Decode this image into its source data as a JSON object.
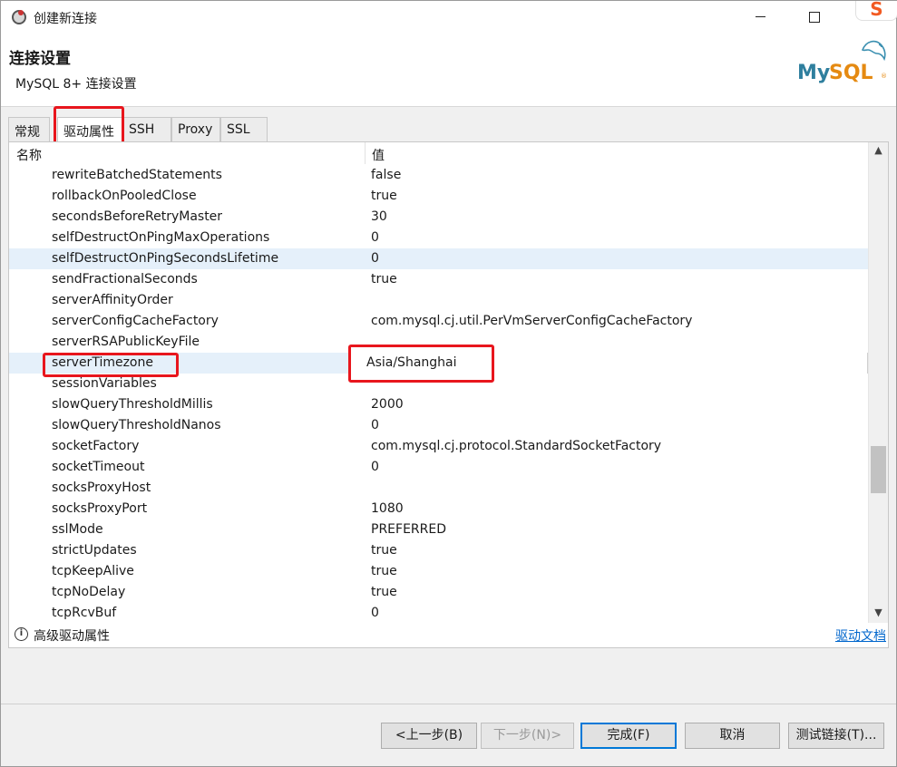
{
  "window": {
    "title": "创建新连接",
    "ime_badge": "S"
  },
  "header": {
    "title": "连接设置",
    "subtitle": "MySQL 8+ 连接设置",
    "logo_text": "MySQL"
  },
  "tabs": [
    {
      "label": "常规",
      "active": false
    },
    {
      "label": "驱动属性",
      "active": true
    },
    {
      "label": "SSH",
      "active": false
    },
    {
      "label": "Proxy",
      "active": false
    },
    {
      "label": "SSL",
      "active": false
    }
  ],
  "table": {
    "col_name": "名称",
    "col_value": "值",
    "rows": [
      {
        "name": "rewriteBatchedStatements",
        "value": "false"
      },
      {
        "name": "rollbackOnPooledClose",
        "value": "true"
      },
      {
        "name": "secondsBeforeRetryMaster",
        "value": "30"
      },
      {
        "name": "selfDestructOnPingMaxOperations",
        "value": "0"
      },
      {
        "name": "selfDestructOnPingSecondsLifetime",
        "value": "0"
      },
      {
        "name": "sendFractionalSeconds",
        "value": "true"
      },
      {
        "name": "serverAffinityOrder",
        "value": ""
      },
      {
        "name": "serverConfigCacheFactory",
        "value": "com.mysql.cj.util.PerVmServerConfigCacheFactory"
      },
      {
        "name": "serverRSAPublicKeyFile",
        "value": ""
      },
      {
        "name": "serverTimezone",
        "value": "Asia/Shanghai"
      },
      {
        "name": "sessionVariables",
        "value": ""
      },
      {
        "name": "slowQueryThresholdMillis",
        "value": "2000"
      },
      {
        "name": "slowQueryThresholdNanos",
        "value": "0"
      },
      {
        "name": "socketFactory",
        "value": "com.mysql.cj.protocol.StandardSocketFactory"
      },
      {
        "name": "socketTimeout",
        "value": "0"
      },
      {
        "name": "socksProxyHost",
        "value": ""
      },
      {
        "name": "socksProxyPort",
        "value": "1080"
      },
      {
        "name": "sslMode",
        "value": "PREFERRED"
      },
      {
        "name": "strictUpdates",
        "value": "true"
      },
      {
        "name": "tcpKeepAlive",
        "value": "true"
      },
      {
        "name": "tcpNoDelay",
        "value": "true"
      },
      {
        "name": "tcpRcvBuf",
        "value": "0"
      }
    ],
    "scroll_position": 0.72
  },
  "footer": {
    "advanced_label": "高级驱动属性",
    "doc_link": "驱动文档"
  },
  "buttons": {
    "back": "<上一步(B)",
    "next": "下一步(N)>",
    "finish": "完成(F)",
    "cancel": "取消",
    "test": "测试链接(T)..."
  },
  "colors": {
    "highlight_box": "#e8161d",
    "selected_row": "#e5f0fa",
    "link": "#0066cc",
    "default_button_border": "#0078d7"
  }
}
